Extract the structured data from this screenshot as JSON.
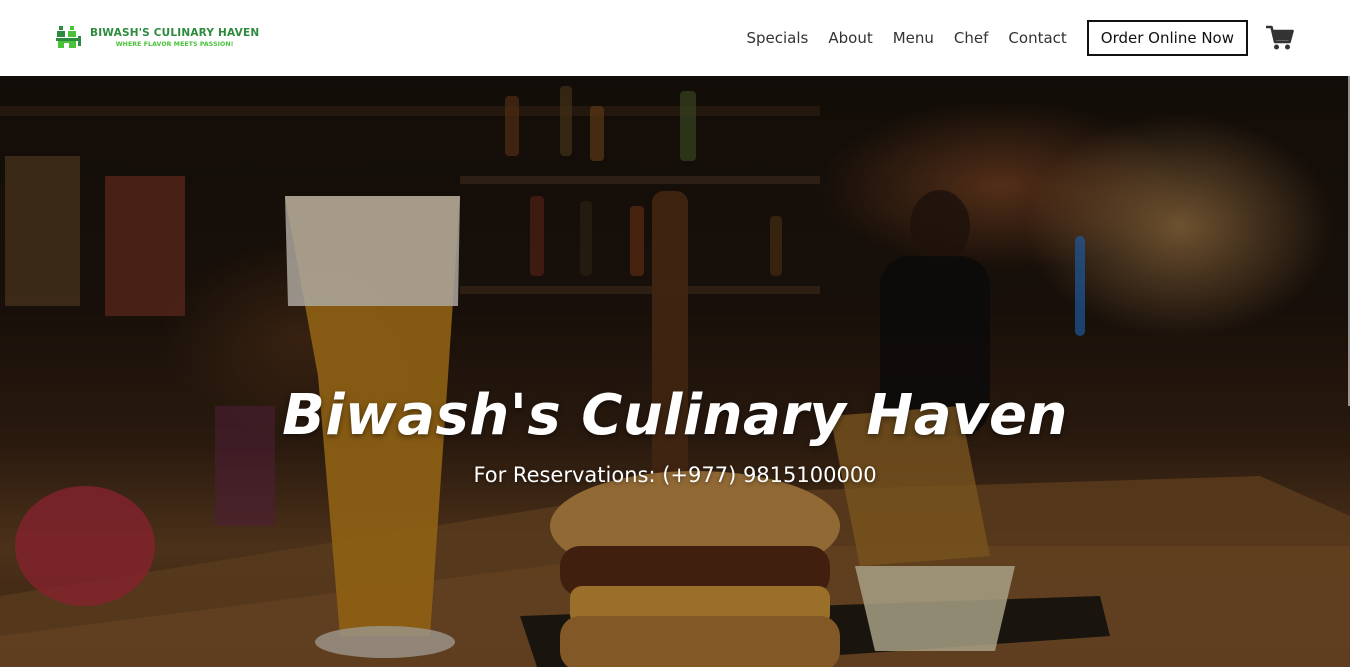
{
  "brand": {
    "name": "BIWASH'S CULINARY HAVEN",
    "tagline": "WHERE FLAVOR MEETS PASSION!",
    "logo_icon": "chef-logo-icon"
  },
  "nav": {
    "items": [
      {
        "label": "Specials"
      },
      {
        "label": "About"
      },
      {
        "label": "Menu"
      },
      {
        "label": "Chef"
      },
      {
        "label": "Contact"
      }
    ],
    "order_button": "Order Online Now",
    "cart_icon": "shopping-cart-icon"
  },
  "hero": {
    "title": "Biwash's Culinary Haven",
    "subtitle": "For Reservations: (+977) 9815100000"
  },
  "colors": {
    "brand_green": "#2e8b3e",
    "tagline_green": "#49c23a",
    "nav_text": "#333333",
    "button_border": "#111111",
    "hero_text": "#ffffff"
  }
}
